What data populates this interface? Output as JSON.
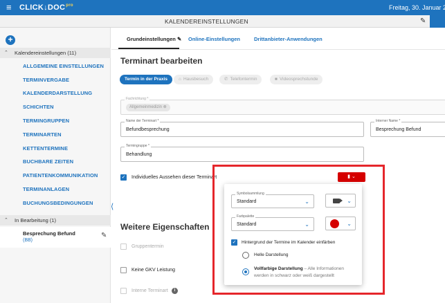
{
  "topbar": {
    "logo": "CLICK",
    "logo_arrow": "↓",
    "logo_rest": "DOC",
    "logo_pro": "pro",
    "date": "Freitag, 30. Januar 2"
  },
  "subbar": {
    "title": "KALENDEREINSTELLUNGEN"
  },
  "sidebar": {
    "section_settings": "Kalendereinstellungen (11)",
    "items": [
      "ALLGEMEINE EINSTELLUNGEN",
      "TERMINVERGABE",
      "KALENDERDARSTELLUNG",
      "SCHICHTEN",
      "TERMINGRUPPEN",
      "TERMINARTEN",
      "KETTENTERMINE",
      "BUCHBARE ZEITEN",
      "PATIENTENKOMMUNIKATION",
      "TERMINANLAGEN",
      "BUCHUNGSBEDINGUNGEN"
    ],
    "section_editing": "In Bearbeitung (1)",
    "editing_item": {
      "name": "Besprechung Befund",
      "code": "(BB)"
    }
  },
  "tabs": {
    "basic": "Grundeinstellungen",
    "online": "Online-Einstellungen",
    "third_party": "Drittanbieter-Anwendungen"
  },
  "form": {
    "title": "Terminart bearbeiten",
    "modes": [
      "Termin in der Praxis",
      "Hausbesuch",
      "Telefontermin",
      "Videosprechstunde"
    ],
    "specialty_label": "Fachrichtung *",
    "specialty_value": "Allgemeinmedizin",
    "name_label": "Name der Terminart *",
    "name_value": "Befundbesprechung",
    "internal_label": "Interner Name *",
    "internal_value": "Besprechung Befund",
    "group_label": "Termingruppe *",
    "group_value": "Behandlung",
    "individual_look": "Individuelles Aussehen dieser Terminart"
  },
  "more": {
    "title": "Weitere Eigenschaften",
    "group_appt": "Gruppentermin",
    "no_gkv": "Keine GKV Leistung",
    "internal_appt": "Interne Terminart"
  },
  "popup": {
    "symbol_label": "Symbolsammlung",
    "symbol_value": "Standard",
    "palette_label": "Farbpalette",
    "palette_value": "Standard",
    "bg_color": "Hintergrund der Termine im Kalender einfärben",
    "light": "Helle Darstellung",
    "full_title": "Vollfarbige Darstellung",
    "full_desc_1": "– Alle Informationen",
    "full_desc_2": "werden in schwarz oder weiß dargestellt"
  },
  "colors": {
    "brand": "#1e73be",
    "selected_color": "#d50000",
    "highlight": "#e5262b"
  }
}
